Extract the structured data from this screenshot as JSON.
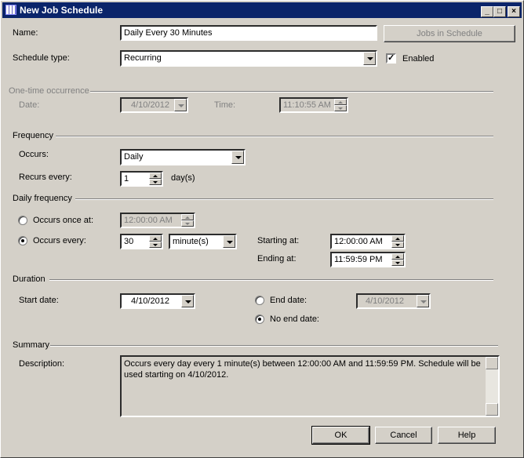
{
  "window": {
    "title": "New Job Schedule",
    "minimize": "_",
    "maximize": "□",
    "close": "×"
  },
  "name": {
    "label": "Name:",
    "value": "Daily Every 30 Minutes"
  },
  "jobs_button": "Jobs in Schedule",
  "schedule_type": {
    "label": "Schedule type:",
    "value": "Recurring"
  },
  "enabled": {
    "label": "Enabled",
    "checked": true
  },
  "one_time": {
    "header": "One-time occurrence",
    "date_label": "Date:",
    "date": "4/10/2012",
    "time_label": "Time:",
    "time": "11:10:55 AM"
  },
  "frequency": {
    "header": "Frequency",
    "occurs_label": "Occurs:",
    "occurs": "Daily",
    "recurs_label": "Recurs every:",
    "recurs": "1",
    "recurs_unit": "day(s)"
  },
  "daily": {
    "header": "Daily frequency",
    "once_label": "Occurs once at:",
    "once_time": "12:00:00 AM",
    "every_label": "Occurs every:",
    "every_value": "30",
    "every_unit": "minute(s)",
    "starting_label": "Starting at:",
    "starting": "12:00:00 AM",
    "ending_label": "Ending at:",
    "ending": "11:59:59 PM",
    "selected": "every"
  },
  "duration": {
    "header": "Duration",
    "start_label": "Start date:",
    "start": "4/10/2012",
    "end_label": "End date:",
    "end": "4/10/2012",
    "noend_label": "No end date:",
    "selected": "noend"
  },
  "summary": {
    "header": "Summary",
    "desc_label": "Description:",
    "description": "Occurs every day every 1 minute(s) between 12:00:00 AM and 11:59:59 PM. Schedule will be used starting on 4/10/2012."
  },
  "buttons": {
    "ok": "OK",
    "cancel": "Cancel",
    "help": "Help"
  }
}
